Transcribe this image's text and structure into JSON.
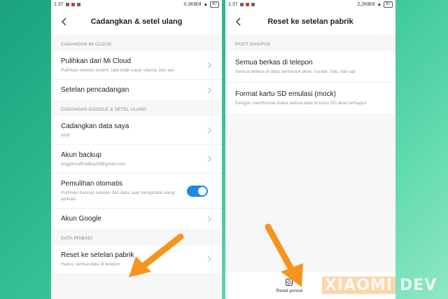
{
  "left_screen": {
    "status": {
      "time": "1:37",
      "speed": "0,3KB/d",
      "battery": "87"
    },
    "title": "Cadangkan & setel ulang",
    "sections": [
      {
        "header": "CADANGAN MI CLOUD",
        "items": [
          {
            "title": "Pulihkan dari Mi Cloud",
            "subtitle": "Pulihkan setelan sistem, tata letak Layar utama, dan apl"
          },
          {
            "title": "Setelan pencadangan",
            "subtitle": ""
          }
        ]
      },
      {
        "header": "CADANGAN GOOGLE & SETEL ULANG",
        "items": [
          {
            "title": "Cadangkan data saya",
            "subtitle": "Aktif"
          },
          {
            "title": "Akun backup",
            "subtitle": "anggiinsaffradika28@gmail.com"
          },
          {
            "title": "Pemulihan otomatis",
            "subtitle": "Pulihkan backup setelan dan data saat menginstal ulang aplikasi",
            "toggle": "on"
          },
          {
            "title": "Akun Google",
            "subtitle": ""
          }
        ]
      },
      {
        "header": "DATA PRIBADI",
        "items": [
          {
            "title": "Reset ke setelan pabrik",
            "subtitle": "Hapus semua data di telepon"
          }
        ]
      }
    ]
  },
  "right_screen": {
    "status": {
      "time": "1:37",
      "speed": "2,2KB/d",
      "battery": "87"
    },
    "title": "Reset ke setelan pabrik",
    "section_header": "PASTI DIHAPUS",
    "items": [
      {
        "title": "Semua berkas di telepon",
        "subtitle": "Semua berkas di data, termasuk akun, kontak, foto, dan apl"
      },
      {
        "title": "Format kartu SD emulasi (mock)",
        "subtitle": "Dengan memformat maka semua data di kartu SD akan terhapus"
      }
    ],
    "reset_button": {
      "label": "Reset ponsel",
      "icon": "phone-reset-icon"
    }
  },
  "watermark": {
    "part1": "XIAOMI",
    "part2": "DEV"
  },
  "colors": {
    "arrow": "#f7941d",
    "toggle": "#1e88e5",
    "background": "#34c296"
  }
}
